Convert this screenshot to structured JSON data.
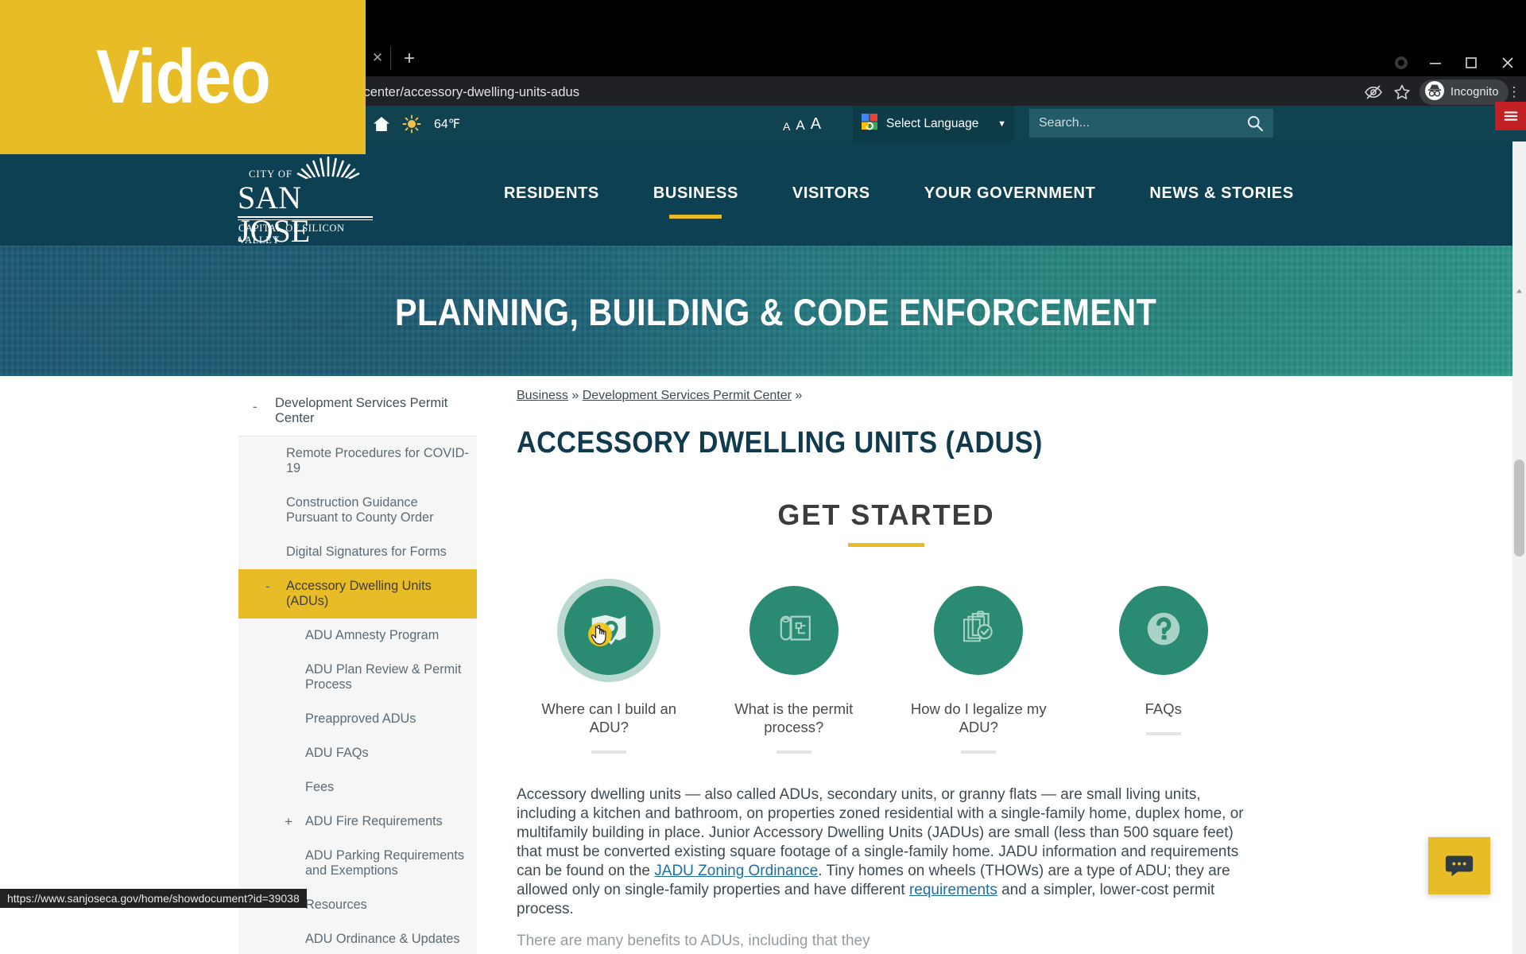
{
  "browser": {
    "tab_close_glyph": "✕",
    "new_tab_glyph": "+",
    "url": "mit-center/accessory-dwelling-units-adus",
    "incognito_label": "Incognito",
    "menu_glyph": "⋮",
    "icons": {
      "eye_off": "eye-off-icon",
      "star": "bookmark-star-icon",
      "incognito": "incognito-icon",
      "minimize": "minimize-icon",
      "maximize": "maximize-icon",
      "close": "window-close-icon",
      "record": "record-indicator-icon"
    }
  },
  "status_bar": {
    "url": "https://www.sanjoseca.gov/home/showdocument?id=39038"
  },
  "utility_bar": {
    "icons": [
      "youtube-icon",
      "home-icon",
      "sun-icon"
    ],
    "weather": "64℉",
    "text_size": {
      "small": "A",
      "medium": "A",
      "large": "A"
    },
    "language": {
      "label": "Select Language",
      "caret": "▼"
    },
    "search": {
      "placeholder": "Search...",
      "value": ""
    }
  },
  "site_header": {
    "logo": {
      "city_of": "CITY OF",
      "name": "SAN JOSE",
      "tagline": "CAPITAL OF SILICON VALLEY"
    },
    "nav": [
      {
        "label": "RESIDENTS",
        "active": false
      },
      {
        "label": "BUSINESS",
        "active": true
      },
      {
        "label": "VISITORS",
        "active": false
      },
      {
        "label": "YOUR GOVERNMENT",
        "active": false
      },
      {
        "label": "NEWS & STORIES",
        "active": false
      }
    ]
  },
  "hero": {
    "title": "PLANNING, BUILDING & CODE ENFORCEMENT"
  },
  "sidebar": {
    "root": {
      "label": "Development Services Permit Center",
      "toggle": "-"
    },
    "items": [
      {
        "label": "Remote Procedures for COVID-19",
        "toggle": "",
        "level": 1,
        "active": false
      },
      {
        "label": "Construction Guidance Pursuant to County Order",
        "toggle": "",
        "level": 1,
        "active": false
      },
      {
        "label": "Digital Signatures for Forms",
        "toggle": "",
        "level": 1,
        "active": false
      },
      {
        "label": "Accessory Dwelling Units (ADUs)",
        "toggle": "-",
        "level": 1,
        "active": true
      },
      {
        "label": "ADU Amnesty Program",
        "toggle": "",
        "level": 2,
        "active": false
      },
      {
        "label": "ADU Plan Review & Permit Process",
        "toggle": "",
        "level": 2,
        "active": false
      },
      {
        "label": "Preapproved ADUs",
        "toggle": "",
        "level": 2,
        "active": false
      },
      {
        "label": "ADU FAQs",
        "toggle": "",
        "level": 2,
        "active": false
      },
      {
        "label": "Fees",
        "toggle": "",
        "level": 2,
        "active": false
      },
      {
        "label": "ADU Fire Requirements",
        "toggle": "+",
        "level": 2,
        "active": false
      },
      {
        "label": "ADU Parking Requirements and Exemptions",
        "toggle": "",
        "level": 2,
        "active": false
      },
      {
        "label": "Resources",
        "toggle": "",
        "level": 2,
        "active": false
      },
      {
        "label": "ADU Ordinance & Updates",
        "toggle": "",
        "level": 2,
        "active": false
      }
    ]
  },
  "content": {
    "breadcrumb": {
      "item1": "Business",
      "sep1": " » ",
      "item2": "Development Services Permit Center",
      "sep2": " »"
    },
    "page_title": "ACCESSORY DWELLING UNITS (ADUS)",
    "get_started": {
      "title": "GET STARTED"
    },
    "cards": [
      {
        "label": "Where can I build an ADU?",
        "icon": "map-pin-icon",
        "hovered": true
      },
      {
        "label": "What is the permit process?",
        "icon": "blueprint-roll-icon",
        "hovered": false
      },
      {
        "label": "How do I legalize my ADU?",
        "icon": "clipboard-check-icon",
        "hovered": false
      },
      {
        "label": "FAQs",
        "icon": "question-mark-icon",
        "hovered": false
      }
    ],
    "paragraph": {
      "part1": "Accessory dwelling units — also called ADUs, secondary units, or granny flats — are small living units, including a kitchen and bathroom, on properties zoned residential with a single-family home, duplex home, or multifamily building in place. Junior Accessory Dwelling Units (JADUs) are small (less than 500 square feet) that must be converted existing square footage of a single-family home. JADU information and requirements can be found on the ",
      "link1": "JADU Zoning Ordinance",
      "part2": ". Tiny homes on wheels (THOWs) are a type of ADU; they are allowed only on single-family properties and have different ",
      "link2": "requirements",
      "part3": " and a simpler, lower-cost permit process."
    },
    "paragraph2": "There are many benefits to ADUs, including that they"
  },
  "overlays": {
    "video_badge": "Video",
    "chat_icon": "chat-bubble-icon"
  },
  "colors": {
    "brand_teal": "#0d4052",
    "brand_yellow": "#e8bc26",
    "circle_green": "#2a8a72",
    "hero_gradient_start": "#1d5a74",
    "hero_gradient_end": "#2f9a8c"
  }
}
